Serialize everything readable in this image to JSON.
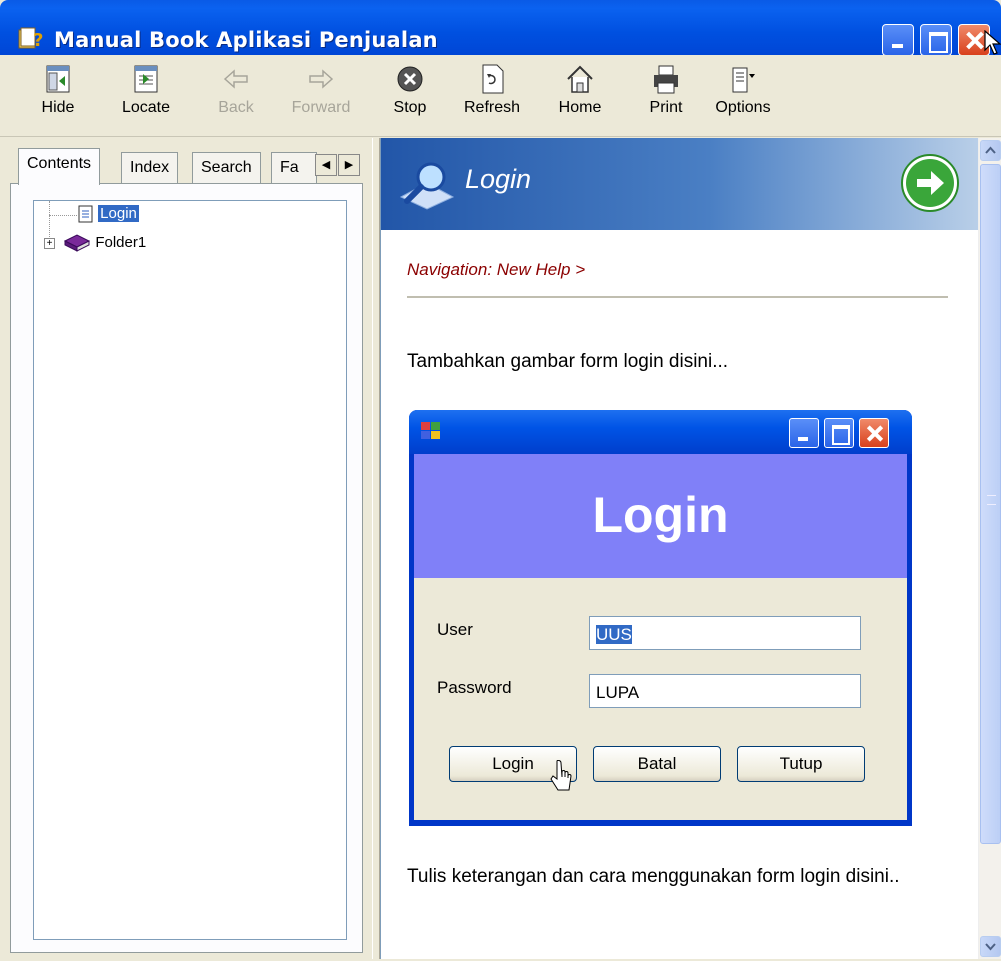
{
  "window": {
    "title": "Manual Book Aplikasi Penjualan",
    "colors": {
      "titlebar": "#0050e0",
      "face": "#ece9d8",
      "close": "#d8401c"
    }
  },
  "toolbar": {
    "hide": "Hide",
    "locate": "Locate",
    "back": "Back",
    "forward": "Forward",
    "stop": "Stop",
    "refresh": "Refresh",
    "home": "Home",
    "print": "Print",
    "options": "Options"
  },
  "navpane": {
    "tabs": {
      "contents": "Contents",
      "index": "Index",
      "search": "Search",
      "favorites": "Fa"
    },
    "tree": {
      "item1": "Login",
      "item2": "Folder1"
    }
  },
  "topic": {
    "title": "Login",
    "navigation": "Navigation: New Help >",
    "para1": "Tambahkan gambar form login disini...",
    "para2": "Tulis keterangan dan cara menggunakan form login disini.."
  },
  "login_form": {
    "header": "Login",
    "user_label": "User",
    "user_value": "UUS",
    "password_label": "Password",
    "password_value": "LUPA",
    "btn_login": "Login",
    "btn_batal": "Batal",
    "btn_tutup": "Tutup",
    "header_color": "#8080f8"
  }
}
